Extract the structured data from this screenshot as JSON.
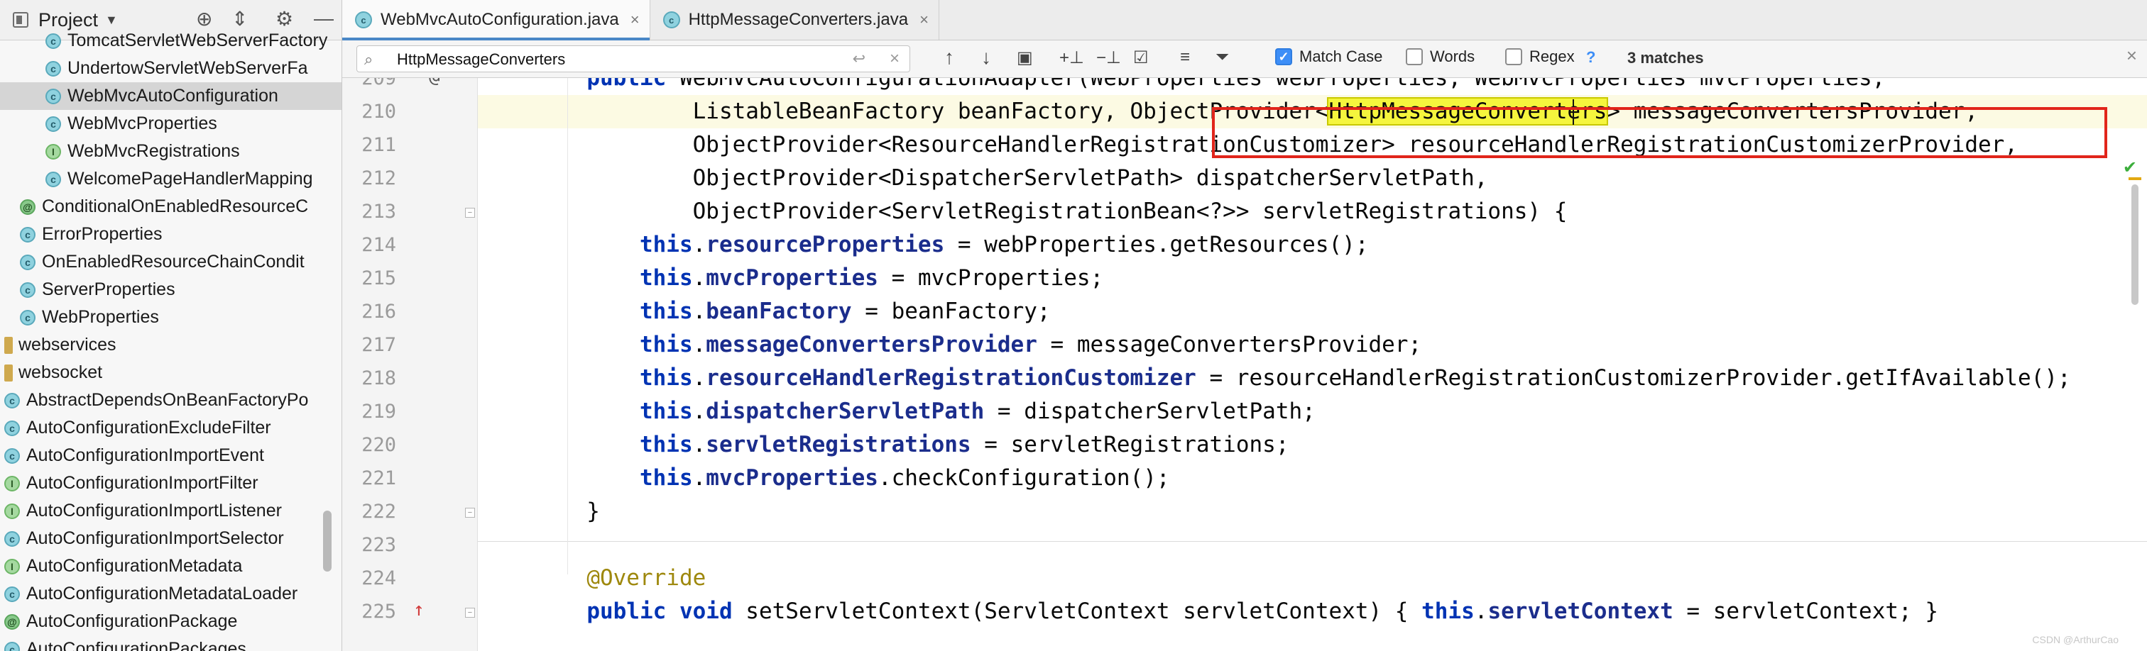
{
  "project_panel": {
    "title": "Project",
    "items": [
      {
        "label": "TomcatServletWebServerFactory",
        "icon": "class-icon",
        "kind": "class",
        "indent": 3
      },
      {
        "label": "UndertowServletWebServerFa",
        "icon": "class-icon",
        "kind": "class",
        "indent": 3
      },
      {
        "label": "WebMvcAutoConfiguration",
        "icon": "class-icon",
        "kind": "class",
        "indent": 3,
        "selected": true
      },
      {
        "label": "WebMvcProperties",
        "icon": "class-icon",
        "kind": "class",
        "indent": 3
      },
      {
        "label": "WebMvcRegistrations",
        "icon": "interface-icon",
        "kind": "interface",
        "indent": 3
      },
      {
        "label": "WelcomePageHandlerMapping",
        "icon": "class-icon",
        "kind": "class",
        "indent": 3
      },
      {
        "label": "ConditionalOnEnabledResourceC",
        "icon": "annotation-icon",
        "kind": "annotation",
        "indent": 1
      },
      {
        "label": "ErrorProperties",
        "icon": "class-icon",
        "kind": "class",
        "indent": 1
      },
      {
        "label": "OnEnabledResourceChainCondit",
        "icon": "class-icon",
        "kind": "class",
        "indent": 1
      },
      {
        "label": "ServerProperties",
        "icon": "class-icon",
        "kind": "class",
        "indent": 1
      },
      {
        "label": "WebProperties",
        "icon": "class-icon",
        "kind": "class",
        "indent": 1
      },
      {
        "label": "webservices",
        "icon": "folder-icon",
        "kind": "folder",
        "indent": 0
      },
      {
        "label": "websocket",
        "icon": "folder-icon",
        "kind": "folder",
        "indent": 0
      },
      {
        "label": "AbstractDependsOnBeanFactoryPo",
        "icon": "class-icon",
        "kind": "class",
        "indent": 0
      },
      {
        "label": "AutoConfigurationExcludeFilter",
        "icon": "class-icon",
        "kind": "class",
        "indent": 0
      },
      {
        "label": "AutoConfigurationImportEvent",
        "icon": "class-icon",
        "kind": "class",
        "indent": 0
      },
      {
        "label": "AutoConfigurationImportFilter",
        "icon": "interface-icon",
        "kind": "interface",
        "indent": 0
      },
      {
        "label": "AutoConfigurationImportListener",
        "icon": "interface-icon",
        "kind": "interface",
        "indent": 0
      },
      {
        "label": "AutoConfigurationImportSelector",
        "icon": "class-icon",
        "kind": "class",
        "indent": 0
      },
      {
        "label": "AutoConfigurationMetadata",
        "icon": "interface-icon",
        "kind": "interface",
        "indent": 0
      },
      {
        "label": "AutoConfigurationMetadataLoader",
        "icon": "class-icon",
        "kind": "class",
        "indent": 0
      },
      {
        "label": "AutoConfigurationPackage",
        "icon": "annotation-icon",
        "kind": "annotation",
        "indent": 0
      },
      {
        "label": "AutoConfigurationPackages",
        "icon": "class-icon",
        "kind": "class",
        "indent": 0
      }
    ]
  },
  "tabs": [
    {
      "label": "WebMvcAutoConfiguration.java",
      "active": true
    },
    {
      "label": "HttpMessageConverters.java",
      "active": false
    }
  ],
  "find_bar": {
    "query": "HttpMessageConverters",
    "match_case_label": "Match Case",
    "match_case_checked": true,
    "words_label": "Words",
    "words_checked": false,
    "regex_label": "Regex",
    "regex_checked": false,
    "help_label": "?",
    "match_count": "3 matches"
  },
  "editor": {
    "current_line": 210,
    "lines": [
      {
        "num": "209",
        "mark": "@",
        "tokens": [
          [
            "        ",
            ""
          ],
          [
            "public",
            "kw"
          ],
          [
            " WebMvcAutoConfigurationAdapter(WebProperties webProperties, WebMvcProperties mvcProperties,",
            ""
          ]
        ]
      },
      {
        "num": "210",
        "tokens": [
          [
            "                ListableBeanFactory beanFactory, ObjectProvider<",
            ""
          ],
          [
            "HttpMessageConverters",
            "hl"
          ],
          [
            "> messageConvertersProvider,",
            ""
          ]
        ]
      },
      {
        "num": "211",
        "tokens": [
          [
            "                ObjectProvider<ResourceHandlerRegistrationCustomizer> resourceHandlerRegistrationCustomizerProvider,",
            ""
          ]
        ]
      },
      {
        "num": "212",
        "tokens": [
          [
            "                ObjectProvider<DispatcherServletPath> dispatcherServletPath,",
            ""
          ]
        ]
      },
      {
        "num": "213",
        "fold": true,
        "tokens": [
          [
            "                ObjectProvider<ServletRegistrationBean<?>> servletRegistrations) {",
            ""
          ]
        ]
      },
      {
        "num": "214",
        "tokens": [
          [
            "            ",
            ""
          ],
          [
            "this",
            "kw"
          ],
          [
            ".",
            ""
          ],
          [
            "resourceProperties",
            "fldb"
          ],
          [
            " = webProperties.getResources();",
            ""
          ]
        ]
      },
      {
        "num": "215",
        "tokens": [
          [
            "            ",
            ""
          ],
          [
            "this",
            "kw"
          ],
          [
            ".",
            ""
          ],
          [
            "mvcProperties",
            "fldb"
          ],
          [
            " = mvcProperties;",
            ""
          ]
        ]
      },
      {
        "num": "216",
        "tokens": [
          [
            "            ",
            ""
          ],
          [
            "this",
            "kw"
          ],
          [
            ".",
            ""
          ],
          [
            "beanFactory",
            "fldb"
          ],
          [
            " = beanFactory;",
            ""
          ]
        ]
      },
      {
        "num": "217",
        "tokens": [
          [
            "            ",
            ""
          ],
          [
            "this",
            "kw"
          ],
          [
            ".",
            ""
          ],
          [
            "messageConvertersProvider",
            "fldb"
          ],
          [
            " = messageConvertersProvider;",
            ""
          ]
        ]
      },
      {
        "num": "218",
        "tokens": [
          [
            "            ",
            ""
          ],
          [
            "this",
            "kw"
          ],
          [
            ".",
            ""
          ],
          [
            "resourceHandlerRegistrationCustomizer",
            "fldb"
          ],
          [
            " = resourceHandlerRegistrationCustomizerProvider.getIfAvailable();",
            ""
          ]
        ]
      },
      {
        "num": "219",
        "tokens": [
          [
            "            ",
            ""
          ],
          [
            "this",
            "kw"
          ],
          [
            ".",
            ""
          ],
          [
            "dispatcherServletPath",
            "fldb"
          ],
          [
            " = dispatcherServletPath;",
            ""
          ]
        ]
      },
      {
        "num": "220",
        "tokens": [
          [
            "            ",
            ""
          ],
          [
            "this",
            "kw"
          ],
          [
            ".",
            ""
          ],
          [
            "servletRegistrations",
            "fldb"
          ],
          [
            " = servletRegistrations;",
            ""
          ]
        ]
      },
      {
        "num": "221",
        "tokens": [
          [
            "            ",
            ""
          ],
          [
            "this",
            "kw"
          ],
          [
            ".",
            ""
          ],
          [
            "mvcProperties",
            "fldb"
          ],
          [
            ".checkConfiguration();",
            ""
          ]
        ]
      },
      {
        "num": "222",
        "fold": true,
        "tokens": [
          [
            "        }",
            ""
          ]
        ]
      },
      {
        "num": "223",
        "tokens": [
          [
            "",
            ""
          ]
        ]
      },
      {
        "num": "224",
        "tokens": [
          [
            "        ",
            ""
          ],
          [
            "@Override",
            "ann"
          ]
        ]
      },
      {
        "num": "225",
        "mark": "↑",
        "fold": true,
        "tokens": [
          [
            "        ",
            ""
          ],
          [
            "public",
            "kw"
          ],
          [
            " ",
            ""
          ],
          [
            "void",
            "kw"
          ],
          [
            " setServletContext(ServletContext servletContext) { ",
            ""
          ],
          [
            "this",
            "kw"
          ],
          [
            ".",
            ""
          ],
          [
            "servletContext",
            "fldb"
          ],
          [
            " = servletContext; }",
            ""
          ]
        ]
      }
    ]
  },
  "watermark": "CSDN @ArthurCao"
}
